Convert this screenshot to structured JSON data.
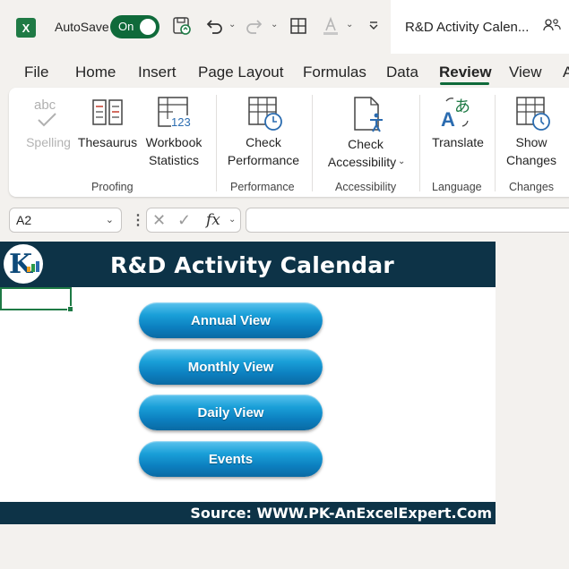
{
  "titlebar": {
    "app_icon": "excel-logo",
    "autosave_label": "AutoSave",
    "autosave_state": "On",
    "doc_title": "R&D Activity Calen...",
    "icons": [
      "save-icon",
      "undo-icon",
      "redo-icon",
      "borders-icon",
      "font-color-icon",
      "customize-toolbar-icon",
      "share-people-icon"
    ]
  },
  "menu": {
    "tabs": [
      "File",
      "Home",
      "Insert",
      "Page Layout",
      "Formulas",
      "Data",
      "Review",
      "View",
      "A"
    ],
    "active": "Review",
    "accent_color": "#0f6a3a"
  },
  "ribbon": {
    "proofing": {
      "label": "Proofing",
      "spelling": "Spelling",
      "thesaurus": "Thesaurus",
      "workbook_line1": "Workbook",
      "workbook_line2": "Statistics"
    },
    "performance": {
      "label": "Performance",
      "line1": "Check",
      "line2": "Performance"
    },
    "accessibility": {
      "label": "Accessibility",
      "line1": "Check",
      "line2": "Accessibility"
    },
    "language": {
      "label": "Language",
      "translate": "Translate"
    },
    "changes": {
      "label": "Changes",
      "line1": "Show",
      "line2": "Changes"
    }
  },
  "formula_bar": {
    "name_box": "A2",
    "fx": "fx",
    "formula": ""
  },
  "sheet": {
    "title": "R&D Activity Calendar",
    "header_color": "#0d3347",
    "buttons": [
      "Annual View",
      "Monthly View",
      "Daily View",
      "Events"
    ],
    "source": "Source: WWW.PK-AnExcelExpert.Com"
  }
}
